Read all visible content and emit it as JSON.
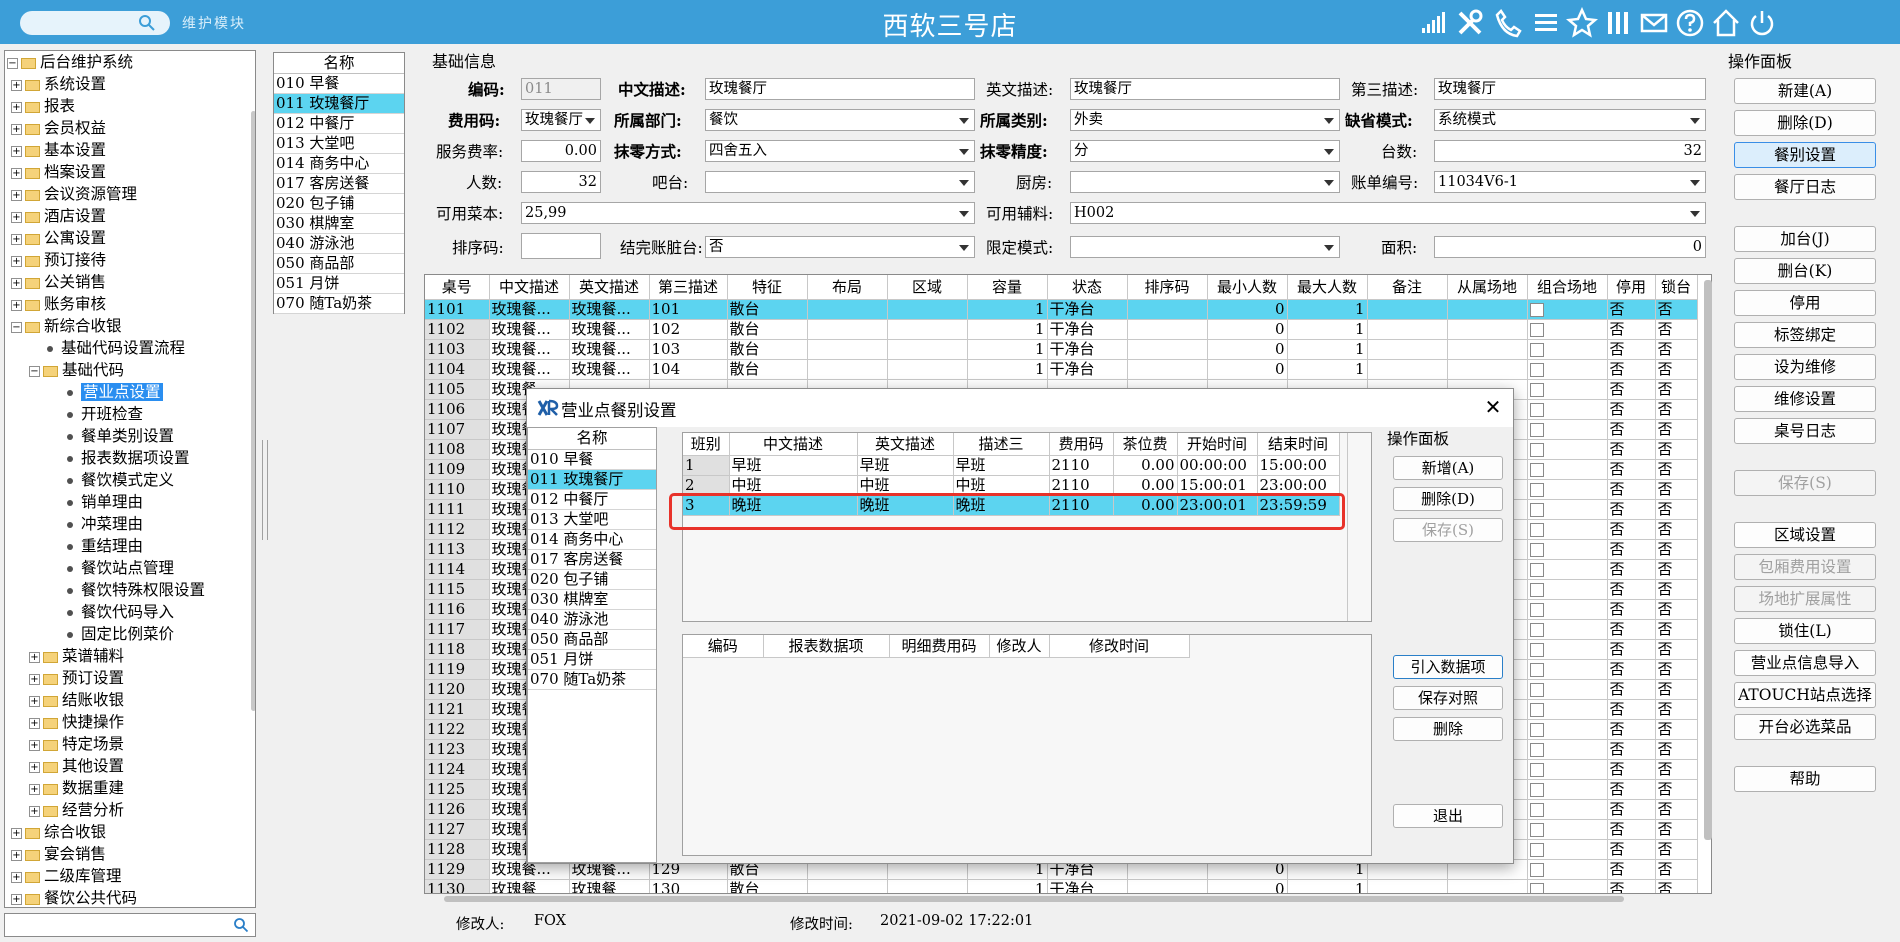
{
  "header": {
    "module": "维护模块",
    "title": "西软三号店"
  },
  "tree": {
    "root": "后台维护系统",
    "top": [
      "系统设置",
      "报表",
      "会员权益",
      "基本设置",
      "档案设置",
      "会议资源管理",
      "酒店设置",
      "公寓设置",
      "预订接待",
      "公关销售",
      "账务审核"
    ],
    "new_pos": "新综合收银",
    "flow": "基础代码设置流程",
    "basic": "基础代码",
    "basic_children": [
      "营业点设置",
      "开班检查",
      "餐单类别设置",
      "报表数据项设置",
      "餐饮模式定义",
      "销单理由",
      "冲菜理由",
      "重结理由",
      "餐饮站点管理",
      "餐饮特殊权限设置",
      "餐饮代码导入",
      "固定比例菜价"
    ],
    "pos_children": [
      "菜谱辅料",
      "预订设置",
      "结账收银",
      "快捷操作",
      "特定场景",
      "其他设置",
      "数据重建",
      "经营分析"
    ],
    "bottom": [
      "综合收银",
      "宴会销售",
      "二级库管理",
      "餐饮公共代码"
    ]
  },
  "outlets": {
    "header": "名称",
    "rows": [
      "010 早餐",
      "011 玫瑰餐厅",
      "012 中餐厅",
      "013 大堂吧",
      "014 商务中心",
      "017 客房送餐",
      "020 包子铺",
      "030 棋牌室",
      "040 游泳池",
      "050 商品部",
      "051 月饼",
      "070 随Ta奶茶"
    ]
  },
  "form": {
    "section": "基础信息",
    "code_label": "编码:",
    "code": "011",
    "cn_label": "中文描述:",
    "cn": "玫瑰餐厅",
    "en_label": "英文描述:",
    "en": "玫瑰餐厅",
    "third_label": "第三描述:",
    "third": "玫瑰餐厅",
    "fee_label": "费用码:",
    "fee": "玫瑰餐厅",
    "dept_label": "所属部门:",
    "dept": "餐饮",
    "cat_label": "所属类别:",
    "cat": "外卖",
    "mode_label": "缺省模式:",
    "mode": "系统模式",
    "svc_label": "服务费率:",
    "svc": "0.00",
    "round_label": "抹零方式:",
    "round": "四舍五入",
    "prec_label": "抹零精度:",
    "prec": "分",
    "tables_label": "台数:",
    "tables": "32",
    "people_label": "人数:",
    "people": "32",
    "bar_label": "吧台:",
    "bar": "",
    "kitchen_label": "厨房:",
    "kitchen": "",
    "bill_label": "账单编号:",
    "bill": "11034V6-1",
    "menu_label": "可用菜本:",
    "menu": "25,99",
    "aux_label": "可用辅料:",
    "aux": "H002",
    "sort_label": "排序码:",
    "sort": "",
    "dirty_label": "结完账脏台:",
    "dirty": "否",
    "limit_label": "限定模式:",
    "limit": "",
    "area_label": "面积:",
    "area": "0"
  },
  "grid": {
    "headers": [
      "桌号",
      "中文描述",
      "英文描述",
      "第三描述",
      "特征",
      "布局",
      "区域",
      "容量",
      "状态",
      "排序码",
      "最小人数",
      "最大人数",
      "备注",
      "从属场地",
      "组合场地",
      "停用",
      "锁台"
    ],
    "rows": [
      [
        "1101",
        "玫瑰餐...",
        "玫瑰餐...",
        "101",
        "散台",
        "",
        "",
        "1",
        "干净台",
        "",
        "0",
        "1",
        "",
        "",
        "",
        "否",
        "否"
      ],
      [
        "1102",
        "玫瑰餐...",
        "玫瑰餐...",
        "102",
        "散台",
        "",
        "",
        "1",
        "干净台",
        "",
        "0",
        "1",
        "",
        "",
        "",
        "否",
        "否"
      ],
      [
        "1103",
        "玫瑰餐...",
        "玫瑰餐...",
        "103",
        "散台",
        "",
        "",
        "1",
        "干净台",
        "",
        "0",
        "1",
        "",
        "",
        "",
        "否",
        "否"
      ],
      [
        "1104",
        "玫瑰餐...",
        "玫瑰餐...",
        "104",
        "散台",
        "",
        "",
        "1",
        "干净台",
        "",
        "0",
        "1",
        "",
        "",
        "",
        "否",
        "否"
      ],
      [
        "1105",
        "玫瑰餐",
        "",
        "",
        "",
        "",
        "",
        "",
        "",
        "",
        "",
        "",
        "",
        "",
        "",
        "否",
        "否"
      ],
      [
        "1106",
        "玫瑰餐",
        "",
        "",
        "",
        "",
        "",
        "",
        "",
        "",
        "",
        "",
        "",
        "",
        "",
        "否",
        "否"
      ],
      [
        "1107",
        "玫瑰餐",
        "",
        "",
        "",
        "",
        "",
        "",
        "",
        "",
        "",
        "",
        "",
        "",
        "",
        "否",
        "否"
      ],
      [
        "1108",
        "玫瑰餐",
        "",
        "",
        "",
        "",
        "",
        "",
        "",
        "",
        "",
        "",
        "",
        "",
        "",
        "否",
        "否"
      ],
      [
        "1109",
        "玫瑰餐",
        "",
        "",
        "",
        "",
        "",
        "",
        "",
        "",
        "",
        "",
        "",
        "",
        "",
        "否",
        "否"
      ],
      [
        "1110",
        "玫瑰餐",
        "",
        "",
        "",
        "",
        "",
        "",
        "",
        "",
        "",
        "",
        "",
        "",
        "",
        "否",
        "否"
      ],
      [
        "1111",
        "玫瑰餐",
        "",
        "",
        "",
        "",
        "",
        "",
        "",
        "",
        "",
        "",
        "",
        "",
        "",
        "否",
        "否"
      ],
      [
        "1112",
        "玫瑰餐",
        "",
        "",
        "",
        "",
        "",
        "",
        "",
        "",
        "",
        "",
        "",
        "",
        "",
        "否",
        "否"
      ],
      [
        "1113",
        "玫瑰餐",
        "",
        "",
        "",
        "",
        "",
        "",
        "",
        "",
        "",
        "",
        "",
        "",
        "",
        "否",
        "否"
      ],
      [
        "1114",
        "玫瑰餐",
        "",
        "",
        "",
        "",
        "",
        "",
        "",
        "",
        "",
        "",
        "",
        "",
        "",
        "否",
        "否"
      ],
      [
        "1115",
        "玫瑰餐",
        "",
        "",
        "",
        "",
        "",
        "",
        "",
        "",
        "",
        "",
        "",
        "",
        "",
        "否",
        "否"
      ],
      [
        "1116",
        "玫瑰餐",
        "",
        "",
        "",
        "",
        "",
        "",
        "",
        "",
        "",
        "",
        "",
        "",
        "",
        "否",
        "否"
      ],
      [
        "1117",
        "玫瑰餐",
        "",
        "",
        "",
        "",
        "",
        "",
        "",
        "",
        "",
        "",
        "",
        "",
        "",
        "否",
        "否"
      ],
      [
        "1118",
        "玫瑰餐",
        "",
        "",
        "",
        "",
        "",
        "",
        "",
        "",
        "",
        "",
        "",
        "",
        "",
        "否",
        "否"
      ],
      [
        "1119",
        "玫瑰餐",
        "",
        "",
        "",
        "",
        "",
        "",
        "",
        "",
        "",
        "",
        "",
        "",
        "",
        "否",
        "否"
      ],
      [
        "1120",
        "玫瑰餐",
        "",
        "",
        "",
        "",
        "",
        "",
        "",
        "",
        "",
        "",
        "",
        "",
        "",
        "否",
        "否"
      ],
      [
        "1121",
        "玫瑰餐",
        "",
        "",
        "",
        "",
        "",
        "",
        "",
        "",
        "",
        "",
        "",
        "",
        "",
        "否",
        "否"
      ],
      [
        "1122",
        "玫瑰餐",
        "",
        "",
        "",
        "",
        "",
        "",
        "",
        "",
        "",
        "",
        "",
        "",
        "",
        "否",
        "否"
      ],
      [
        "1123",
        "玫瑰餐",
        "",
        "",
        "",
        "",
        "",
        "",
        "",
        "",
        "",
        "",
        "",
        "",
        "",
        "否",
        "否"
      ],
      [
        "1124",
        "玫瑰餐",
        "",
        "",
        "",
        "",
        "",
        "",
        "",
        "",
        "",
        "",
        "",
        "",
        "",
        "否",
        "否"
      ],
      [
        "1125",
        "玫瑰餐",
        "",
        "",
        "",
        "",
        "",
        "",
        "",
        "",
        "",
        "",
        "",
        "",
        "",
        "否",
        "否"
      ],
      [
        "1126",
        "玫瑰餐",
        "",
        "",
        "",
        "",
        "",
        "",
        "",
        "",
        "",
        "",
        "",
        "",
        "",
        "否",
        "否"
      ],
      [
        "1127",
        "玫瑰餐",
        "",
        "",
        "",
        "",
        "",
        "",
        "",
        "",
        "",
        "",
        "",
        "",
        "",
        "否",
        "否"
      ],
      [
        "1128",
        "玫瑰餐",
        "",
        "",
        "",
        "",
        "",
        "",
        "",
        "",
        "",
        "",
        "",
        "",
        "",
        "否",
        "否"
      ],
      [
        "1129",
        "玫瑰餐...",
        "玫瑰餐...",
        "129",
        "散台",
        "",
        "",
        "1",
        "干净台",
        "",
        "0",
        "1",
        "",
        "",
        "",
        "否",
        "否"
      ],
      [
        "1130",
        "玫瑰餐",
        "玫瑰餐",
        "130",
        "散台",
        "",
        "",
        "1",
        "干净台",
        "",
        "0",
        "1",
        "",
        "",
        "",
        "否",
        "否"
      ]
    ]
  },
  "status": {
    "modifier_label": "修改人:",
    "modifier": "FOX",
    "mtime_label": "修改时间:",
    "mtime": "2021-09-02 17:22:01"
  },
  "panel": {
    "title": "操作面板",
    "buttons": [
      "新建(A)",
      "删除(D)",
      "餐别设置",
      "餐厅日志",
      "加台(J)",
      "删台(K)",
      "停用",
      "标签绑定",
      "设为维修",
      "维修设置",
      "桌号日志",
      "保存(S)",
      "区域设置",
      "包厢费用设置",
      "场地扩展属性",
      "锁住(L)",
      "营业点信息导入",
      "ATOUCH站点选择",
      "开台必选菜品",
      "帮助"
    ]
  },
  "dialog": {
    "title": "营业点餐别设置",
    "names_header": "名称",
    "names": [
      "010 早餐",
      "011 玫瑰餐厅",
      "012 中餐厅",
      "013 大堂吧",
      "014 商务中心",
      "017 客房送餐",
      "020 包子铺",
      "030 棋牌室",
      "040 游泳池",
      "050 商品部",
      "051 月饼",
      "070 随Ta奶茶"
    ],
    "shift_headers": [
      "班别",
      "中文描述",
      "英文描述",
      "描述三",
      "费用码",
      "茶位费",
      "开始时间",
      "结束时间"
    ],
    "shifts": [
      [
        "1",
        "早班",
        "早班",
        "早班",
        "2110",
        "0.00",
        "00:00:00",
        "15:00:00"
      ],
      [
        "2",
        "中班",
        "中班",
        "中班",
        "2110",
        "0.00",
        "15:00:01",
        "23:00:00"
      ],
      [
        "3",
        "晚班",
        "晚班",
        "晚班",
        "2110",
        "0.00",
        "23:00:01",
        "23:59:59"
      ]
    ],
    "report_headers": [
      "编码",
      "报表数据项",
      "明细费用码",
      "修改人",
      "修改时间"
    ],
    "panel_title": "操作面板",
    "btn_new": "新增(A)",
    "btn_delete": "删除(D)",
    "btn_save": "保存(S)",
    "btn_import": "引入数据项",
    "btn_save_map": "保存对照",
    "btn_remove": "删除",
    "btn_exit": "退出"
  }
}
